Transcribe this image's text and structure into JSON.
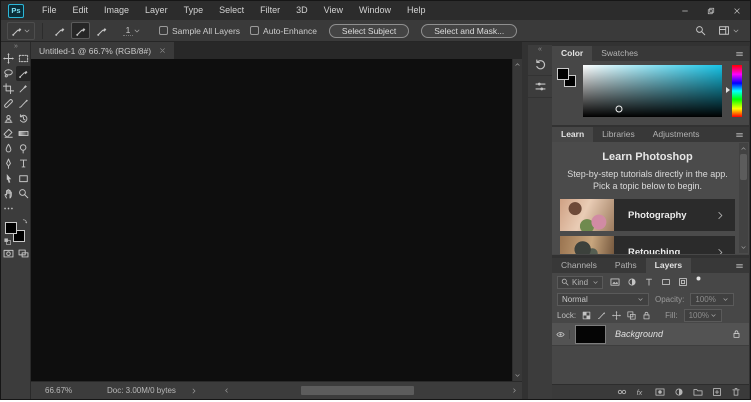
{
  "menu_bar": {
    "items": [
      "File",
      "Edit",
      "Image",
      "Layer",
      "Type",
      "Select",
      "Filter",
      "3D",
      "View",
      "Window",
      "Help"
    ]
  },
  "window_logo": "Ps",
  "window_controls": [
    "minimize",
    "restore",
    "close"
  ],
  "options_bar": {
    "size_value": "1",
    "sample_all_layers_label": "Sample All Layers",
    "sample_all_layers_checked": false,
    "auto_enhance_label": "Auto-Enhance",
    "auto_enhance_checked": false,
    "select_subject_label": "Select Subject",
    "select_and_mask_label": "Select and Mask..."
  },
  "document": {
    "tab_title": "Untitled-1 @ 66.7% (RGB/8#)"
  },
  "status_bar": {
    "zoom": "66.67%",
    "doc_info": "Doc: 3.00M/0 bytes"
  },
  "tools": {
    "items": [
      "move",
      "rectangular-marquee",
      "lasso",
      "quick-selection",
      "crop",
      "eyedropper",
      "spot-healing-brush",
      "brush",
      "clone-stamp",
      "history-brush",
      "eraser",
      "gradient",
      "blur",
      "dodge",
      "pen",
      "type",
      "path-selection",
      "rectangle",
      "hand",
      "zoom",
      "edit-toolbar"
    ],
    "active": "quick-selection",
    "foreground_color": "#000000",
    "background_color": "#000000"
  },
  "dock_strip_icons": [
    "history",
    "properties"
  ],
  "color_panel": {
    "tabs": [
      "Color",
      "Swatches"
    ],
    "active_tab": "Color",
    "hue_hex": "#17c3e6",
    "foreground": "#000000",
    "background": "#000000"
  },
  "learn_panel": {
    "tabs": [
      "Learn",
      "Libraries",
      "Adjustments"
    ],
    "active_tab": "Learn",
    "heading": "Learn Photoshop",
    "description": "Step-by-step tutorials directly in the app. Pick a topic below to begin.",
    "topics": [
      {
        "label": "Photography"
      },
      {
        "label": "Retouching"
      }
    ]
  },
  "layers_panel": {
    "tabs": [
      "Channels",
      "Paths",
      "Layers"
    ],
    "active_tab": "Layers",
    "filter_label": "Kind",
    "filter_icons": [
      "pixel-filter",
      "adjustment-filter",
      "type-filter",
      "shape-filter",
      "smart-object-filter",
      "filter-toggle"
    ],
    "blend_mode": "Normal",
    "opacity_label": "Opacity:",
    "opacity_value": "100%",
    "lock_label": "Lock:",
    "lock_icons": [
      "lock-transparent-pixels",
      "lock-image-pixels",
      "lock-position",
      "lock-artboard",
      "lock-all"
    ],
    "fill_label": "Fill:",
    "fill_value": "100%",
    "layers": [
      {
        "name": "Background",
        "visible": true,
        "locked": true
      }
    ],
    "footer_icons": [
      "link-layers",
      "layer-effects",
      "add-layer-mask",
      "add-adjustment-layer",
      "new-group",
      "new-layer",
      "delete-layer"
    ]
  }
}
